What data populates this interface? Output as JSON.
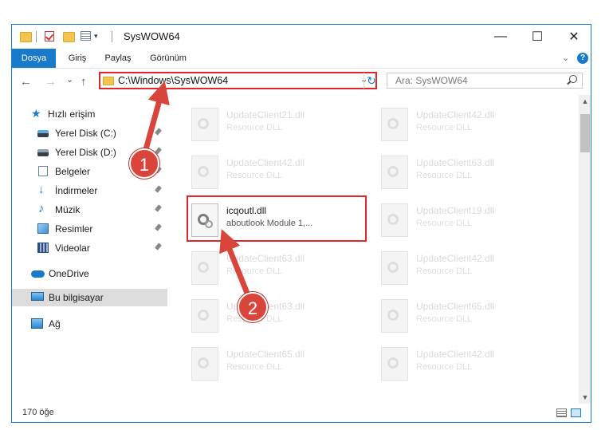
{
  "window": {
    "title": "SysWOW64",
    "controls": {
      "minimize": "—",
      "maximize": "☐",
      "close": "✕"
    }
  },
  "ribbon": {
    "tabs": [
      "Dosya",
      "Giriş",
      "Paylaş",
      "Görünüm"
    ],
    "expand_icon": "chevron-down-icon",
    "help_icon": "?"
  },
  "navigation": {
    "back": "←",
    "forward": "→",
    "recent": "⌄",
    "up": "↑",
    "address": "C:\\Windows\\SysWOW64",
    "refresh": "↻",
    "search_placeholder": "Ara: SysWOW64"
  },
  "sidebar": {
    "items": [
      {
        "label": "Hızlı erişim",
        "icon": "star-icon",
        "pinned": false
      },
      {
        "label": "Yerel Disk (C:)",
        "icon": "drive-icon",
        "pinned": true
      },
      {
        "label": "Yerel Disk (D:)",
        "icon": "drive-icon",
        "pinned": true
      },
      {
        "label": "Belgeler",
        "icon": "documents-icon",
        "pinned": true
      },
      {
        "label": "İndirmeler",
        "icon": "download-icon",
        "pinned": true
      },
      {
        "label": "Müzik",
        "icon": "music-icon",
        "pinned": true
      },
      {
        "label": "Resimler",
        "icon": "pictures-icon",
        "pinned": true
      },
      {
        "label": "Videolar",
        "icon": "videos-icon",
        "pinned": true
      },
      {
        "label": "OneDrive",
        "icon": "cloud-icon",
        "pinned": false
      },
      {
        "label": "Bu bilgisayar",
        "icon": "computer-icon",
        "pinned": false,
        "selected": true
      },
      {
        "label": "Ağ",
        "icon": "network-icon",
        "pinned": false
      }
    ]
  },
  "files": [
    {
      "name": "UpdateClient21.dll",
      "type": "Resource DLL"
    },
    {
      "name": "UpdateClient42.dll",
      "type": "Resource DLL"
    },
    {
      "name": "UpdateClient42.dll",
      "type": "Resource DLL"
    },
    {
      "name": "UpdateClient63.dll",
      "type": "Resource DLL"
    },
    {
      "name": "icqoutl.dll",
      "type": "aboutlook Module 1,...",
      "highlighted": true
    },
    {
      "name": "UpdateClient19.dll",
      "type": "Resource DLL"
    },
    {
      "name": "UpdateClient63.dll",
      "type": "Resource DLL"
    },
    {
      "name": "UpdateClient42.dll",
      "type": "Resource DLL"
    },
    {
      "name": "UpdateClient63.dll",
      "type": "Resource DLL"
    },
    {
      "name": "UpdateClient65.dll",
      "type": "Resource DLL"
    },
    {
      "name": "UpdateClient65.dll",
      "type": "Resource DLL"
    },
    {
      "name": "UpdateClient42.dll",
      "type": "Resource DLL"
    }
  ],
  "status": {
    "item_count": "170 öğe"
  },
  "annotations": {
    "badge_1": "1",
    "badge_2": "2",
    "color": "#d9453a"
  }
}
